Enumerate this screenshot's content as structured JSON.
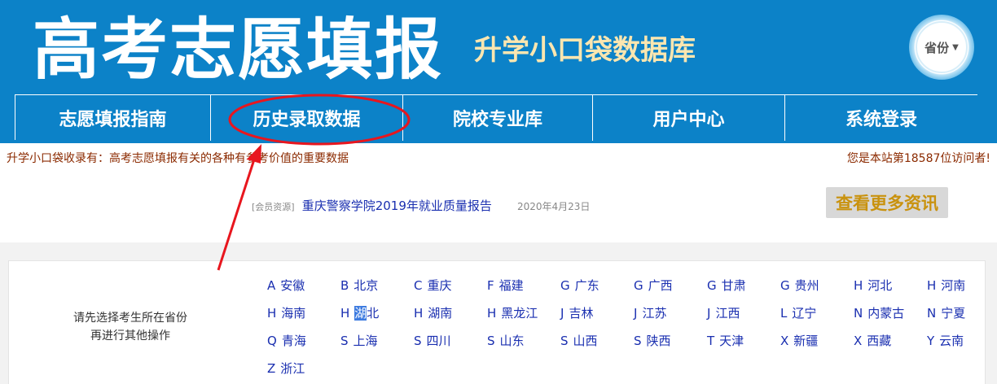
{
  "header": {
    "title": "高考志愿填报",
    "subtitle": "升学小口袋数据库",
    "province_button": {
      "label": "省份",
      "caret": "▼"
    }
  },
  "nav": [
    "志愿填报指南",
    "历史录取数据",
    "院校专业库",
    "用户中心",
    "系统登录"
  ],
  "info": {
    "left": "升学小口袋收录有：高考志愿填报有关的各种有参考价值的重要数据",
    "right": "您是本站第18587位访问者!"
  },
  "news": {
    "tag": "[会员资源]",
    "title": "重庆警察学院2019年就业质量报告",
    "date": "2020年4月23日"
  },
  "more_button": "查看更多资讯",
  "hint": {
    "line1": "请先选择考生所在省份",
    "line2": "再进行其他操作"
  },
  "provinces": [
    {
      "letter": "A",
      "name": "安徽"
    },
    {
      "letter": "B",
      "name": "北京"
    },
    {
      "letter": "C",
      "name": "重庆"
    },
    {
      "letter": "F",
      "name": "福建"
    },
    {
      "letter": "G",
      "name": "广东"
    },
    {
      "letter": "G",
      "name": "广西"
    },
    {
      "letter": "G",
      "name": "甘肃"
    },
    {
      "letter": "G",
      "name": "贵州"
    },
    {
      "letter": "H",
      "name": "河北"
    },
    {
      "letter": "H",
      "name": "河南"
    },
    {
      "letter": "H",
      "name": "海南"
    },
    {
      "letter": "H",
      "name": "湖北"
    },
    {
      "letter": "H",
      "name": "湖南"
    },
    {
      "letter": "H",
      "name": "黑龙江"
    },
    {
      "letter": "J",
      "name": "吉林"
    },
    {
      "letter": "J",
      "name": "江苏"
    },
    {
      "letter": "J",
      "name": "江西"
    },
    {
      "letter": "L",
      "name": "辽宁"
    },
    {
      "letter": "N",
      "name": "内蒙古"
    },
    {
      "letter": "N",
      "name": "宁夏"
    },
    {
      "letter": "Q",
      "name": "青海"
    },
    {
      "letter": "S",
      "name": "上海"
    },
    {
      "letter": "S",
      "name": "四川"
    },
    {
      "letter": "S",
      "name": "山东"
    },
    {
      "letter": "S",
      "name": "山西"
    },
    {
      "letter": "S",
      "name": "陕西"
    },
    {
      "letter": "T",
      "name": "天津"
    },
    {
      "letter": "X",
      "name": "新疆"
    },
    {
      "letter": "X",
      "name": "西藏"
    },
    {
      "letter": "Y",
      "name": "云南"
    },
    {
      "letter": "Z",
      "name": "浙江"
    }
  ],
  "selected_province_index": 11,
  "colors": {
    "header_bg": "#0c82c8",
    "subtitle": "#fbe6b0",
    "info_text": "#8b2a00",
    "link": "#1a2fb0",
    "more_text": "#c9920e",
    "annotation": "#e8161e"
  }
}
